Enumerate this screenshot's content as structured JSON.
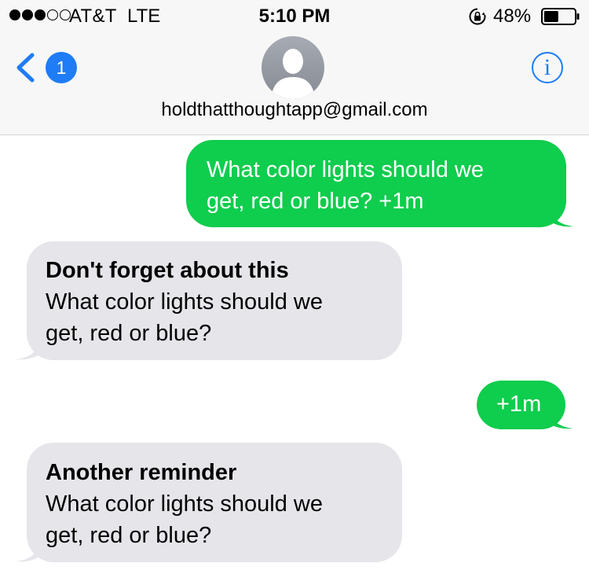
{
  "status_bar": {
    "carrier": "AT&T",
    "network": "LTE",
    "time": "5:10 PM",
    "battery_percent": "48%",
    "signal_bars_filled": 3,
    "signal_bars_total": 5,
    "battery_level": 0.48
  },
  "nav": {
    "back_badge": "1",
    "info_label": "i",
    "contact": "holdthatthoughtapp@gmail.com",
    "accent_color": "#1e7cf6"
  },
  "colors": {
    "sent_bubble": "#0fcd4d",
    "received_bubble": "#e5e5ea"
  },
  "messages": [
    {
      "direction": "sent",
      "lines": [
        "What color lights should we",
        "get, red or blue? +1m"
      ]
    },
    {
      "direction": "received",
      "title": "Don't forget about this",
      "lines": [
        "What color lights should we",
        "get, red or blue?"
      ]
    },
    {
      "direction": "sent",
      "lines": [
        "+1m"
      ]
    },
    {
      "direction": "received",
      "title": "Another reminder",
      "lines": [
        "What color lights should we",
        "get, red or blue?"
      ]
    }
  ]
}
